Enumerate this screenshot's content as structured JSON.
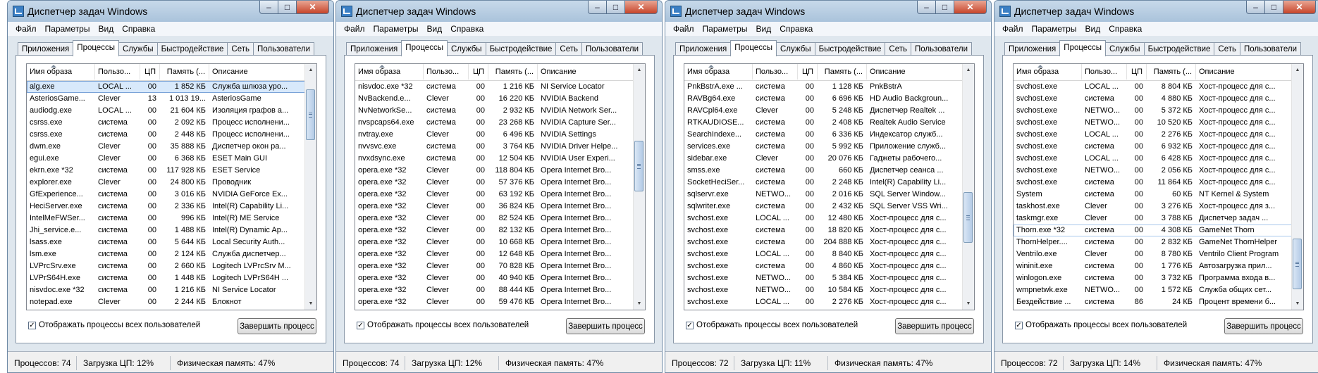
{
  "window": {
    "title": "Диспетчер задач Windows",
    "menu": [
      "Файл",
      "Параметры",
      "Вид",
      "Справка"
    ],
    "tabs": [
      "Приложения",
      "Процессы",
      "Службы",
      "Быстродействие",
      "Сеть",
      "Пользователи"
    ],
    "active_tab": "Процессы",
    "columns": [
      "Имя образа",
      "Пользо...",
      "ЦП",
      "Память (...",
      "Описание"
    ],
    "show_all_label": "Отображать процессы всех пользователей",
    "show_all_checked": true,
    "end_process_label": "Завершить процесс",
    "close_glyph": "✕",
    "minimize_glyph": "–",
    "maximize_glyph": "□"
  },
  "colors": {
    "titlebar": "#aac3db",
    "selection": "#d8e9fb",
    "close_button": "#c7452a"
  },
  "panels": [
    {
      "status": {
        "processes": "Процессов: 74",
        "cpu": "Загрузка ЦП: 12%",
        "memory": "Физическая память: 47%"
      },
      "scroll_position": 0.08,
      "selected_row": 0,
      "rows": [
        [
          "alg.exe",
          "LOCAL ...",
          "00",
          "1 852 КБ",
          "Служба шлюза уро..."
        ],
        [
          "AsteriosGame...",
          "Clever",
          "13",
          "1 013 19...",
          "AsteriosGame"
        ],
        [
          "audiodg.exe",
          "LOCAL ...",
          "00",
          "21 604 КБ",
          "Изоляция графов а..."
        ],
        [
          "csrss.exe",
          "система",
          "00",
          "2 092 КБ",
          "Процесс исполнени..."
        ],
        [
          "csrss.exe",
          "система",
          "00",
          "2 448 КБ",
          "Процесс исполнени..."
        ],
        [
          "dwm.exe",
          "Clever",
          "00",
          "35 888 КБ",
          "Диспетчер окон ра..."
        ],
        [
          "egui.exe",
          "Clever",
          "00",
          "6 368 КБ",
          "ESET Main GUI"
        ],
        [
          "ekrn.exe *32",
          "система",
          "00",
          "117 928 КБ",
          "ESET Service"
        ],
        [
          "explorer.exe",
          "Clever",
          "00",
          "24 800 КБ",
          "Проводник"
        ],
        [
          "GfExperience...",
          "система",
          "00",
          "3 016 КБ",
          "NVIDIA GeForce Ex..."
        ],
        [
          "HeciServer.exe",
          "система",
          "00",
          "2 336 КБ",
          "Intel(R) Capability Li..."
        ],
        [
          "IntelMeFWSer...",
          "система",
          "00",
          "996 КБ",
          "Intel(R) ME Service"
        ],
        [
          "Jhi_service.e...",
          "система",
          "00",
          "1 488 КБ",
          "Intel(R) Dynamic Ap..."
        ],
        [
          "lsass.exe",
          "система",
          "00",
          "5 644 КБ",
          "Local Security Auth..."
        ],
        [
          "lsm.exe",
          "система",
          "00",
          "2 124 КБ",
          "Служба диспетчер..."
        ],
        [
          "LVPrcSrv.exe",
          "система",
          "00",
          "2 660 КБ",
          "Logitech LVPrcSrv M..."
        ],
        [
          "LVPrS64H.exe",
          "система",
          "00",
          "1 448 КБ",
          "Logitech LVPrS64H ..."
        ],
        [
          "nisvdoc.exe *32",
          "система",
          "00",
          "1 216 КБ",
          "NI Service Locator"
        ],
        [
          "notepad.exe",
          "Clever",
          "00",
          "2 244 КБ",
          "Блокнот"
        ]
      ]
    },
    {
      "status": {
        "processes": "Процессов: 74",
        "cpu": "Загрузка ЦП: 12%",
        "memory": "Физическая память: 47%"
      },
      "scroll_position": 0.38,
      "selected_row": -1,
      "rows": [
        [
          "nisvdoc.exe *32",
          "система",
          "00",
          "1 216 КБ",
          "NI Service Locator"
        ],
        [
          "NvBackend.e...",
          "Clever",
          "00",
          "16 220 КБ",
          "NVIDIA Backend"
        ],
        [
          "NvNetworkSe...",
          "система",
          "00",
          "2 932 КБ",
          "NVIDIA Network Ser..."
        ],
        [
          "nvspcaps64.exe",
          "система",
          "00",
          "23 268 КБ",
          "NVIDIA Capture Ser..."
        ],
        [
          "nvtray.exe",
          "Clever",
          "00",
          "6 496 КБ",
          "NVIDIA Settings"
        ],
        [
          "nvvsvc.exe",
          "система",
          "00",
          "3 764 КБ",
          "NVIDIA Driver Helpe..."
        ],
        [
          "nvxdsync.exe",
          "система",
          "00",
          "12 504 КБ",
          "NVIDIA User Experi..."
        ],
        [
          "opera.exe *32",
          "Clever",
          "00",
          "118 804 КБ",
          "Opera Internet Bro..."
        ],
        [
          "opera.exe *32",
          "Clever",
          "00",
          "57 376 КБ",
          "Opera Internet Bro..."
        ],
        [
          "opera.exe *32",
          "Clever",
          "00",
          "63 192 КБ",
          "Opera Internet Bro..."
        ],
        [
          "opera.exe *32",
          "Clever",
          "00",
          "36 824 КБ",
          "Opera Internet Bro..."
        ],
        [
          "opera.exe *32",
          "Clever",
          "00",
          "82 524 КБ",
          "Opera Internet Bro..."
        ],
        [
          "opera.exe *32",
          "Clever",
          "00",
          "82 132 КБ",
          "Opera Internet Bro..."
        ],
        [
          "opera.exe *32",
          "Clever",
          "00",
          "10 668 КБ",
          "Opera Internet Bro..."
        ],
        [
          "opera.exe *32",
          "Clever",
          "00",
          "12 648 КБ",
          "Opera Internet Bro..."
        ],
        [
          "opera.exe *32",
          "Clever",
          "00",
          "70 828 КБ",
          "Opera Internet Bro..."
        ],
        [
          "opera.exe *32",
          "Clever",
          "00",
          "40 940 КБ",
          "Opera Internet Bro..."
        ],
        [
          "opera.exe *32",
          "Clever",
          "00",
          "88 444 КБ",
          "Opera Internet Bro..."
        ],
        [
          "opera.exe *32",
          "Clever",
          "00",
          "59 476 КБ",
          "Opera Internet Bro..."
        ]
      ]
    },
    {
      "status": {
        "processes": "Процессов: 72",
        "cpu": "Загрузка ЦП: 11%",
        "memory": "Физическая память: 47%"
      },
      "scroll_position": 0.68,
      "selected_row": -1,
      "rows": [
        [
          "PnkBstrA.exe ...",
          "система",
          "00",
          "1 128 КБ",
          "PnkBstrA"
        ],
        [
          "RAVBg64.exe",
          "система",
          "00",
          "6 696 КБ",
          "HD Audio Backgroun..."
        ],
        [
          "RAVCpl64.exe",
          "Clever",
          "00",
          "5 248 КБ",
          "Диспетчер Realtek ..."
        ],
        [
          "RTKAUDIOSE...",
          "система",
          "00",
          "2 408 КБ",
          "Realtek Audio Service"
        ],
        [
          "SearchIndexe...",
          "система",
          "00",
          "6 336 КБ",
          "Индексатор служб..."
        ],
        [
          "services.exe",
          "система",
          "00",
          "5 992 КБ",
          "Приложение служб..."
        ],
        [
          "sidebar.exe",
          "Clever",
          "00",
          "20 076 КБ",
          "Гаджеты рабочего..."
        ],
        [
          "smss.exe",
          "система",
          "00",
          "660 КБ",
          "Диспетчер сеанса ..."
        ],
        [
          "SocketHeciSer...",
          "система",
          "00",
          "2 248 КБ",
          "Intel(R) Capability Li..."
        ],
        [
          "sqlservr.exe",
          "NETWO...",
          "00",
          "2 016 КБ",
          "SQL Server Window..."
        ],
        [
          "sqlwriter.exe",
          "система",
          "00",
          "2 432 КБ",
          "SQL Server VSS Wri..."
        ],
        [
          "svchost.exe",
          "LOCAL ...",
          "00",
          "12 480 КБ",
          "Хост-процесс для с..."
        ],
        [
          "svchost.exe",
          "система",
          "00",
          "18 820 КБ",
          "Хост-процесс для с..."
        ],
        [
          "svchost.exe",
          "система",
          "00",
          "204 888 КБ",
          "Хост-процесс для с..."
        ],
        [
          "svchost.exe",
          "LOCAL ...",
          "00",
          "8 840 КБ",
          "Хост-процесс для с..."
        ],
        [
          "svchost.exe",
          "система",
          "00",
          "4 860 КБ",
          "Хост-процесс для с..."
        ],
        [
          "svchost.exe",
          "NETWO...",
          "00",
          "5 384 КБ",
          "Хост-процесс для с..."
        ],
        [
          "svchost.exe",
          "NETWO...",
          "00",
          "10 584 КБ",
          "Хост-процесс для с..."
        ],
        [
          "svchost.exe",
          "LOCAL ...",
          "00",
          "2 276 КБ",
          "Хост-процесс для с..."
        ]
      ]
    },
    {
      "status": {
        "processes": "Процессов: 72",
        "cpu": "Загрузка ЦП: 14%",
        "memory": "Физическая память: 47%"
      },
      "scroll_position": 0.95,
      "selected_row": 12,
      "rows": [
        [
          "svchost.exe",
          "LOCAL ...",
          "00",
          "8 804 КБ",
          "Хост-процесс для с..."
        ],
        [
          "svchost.exe",
          "система",
          "00",
          "4 880 КБ",
          "Хост-процесс для с..."
        ],
        [
          "svchost.exe",
          "NETWO...",
          "00",
          "5 372 КБ",
          "Хост-процесс для с..."
        ],
        [
          "svchost.exe",
          "NETWO...",
          "00",
          "10 520 КБ",
          "Хост-процесс для с..."
        ],
        [
          "svchost.exe",
          "LOCAL ...",
          "00",
          "2 276 КБ",
          "Хост-процесс для с..."
        ],
        [
          "svchost.exe",
          "система",
          "00",
          "6 932 КБ",
          "Хост-процесс для с..."
        ],
        [
          "svchost.exe",
          "LOCAL ...",
          "00",
          "6 428 КБ",
          "Хост-процесс для с..."
        ],
        [
          "svchost.exe",
          "NETWO...",
          "00",
          "2 056 КБ",
          "Хост-процесс для с..."
        ],
        [
          "svchost.exe",
          "система",
          "00",
          "11 864 КБ",
          "Хост-процесс для с..."
        ],
        [
          "System",
          "система",
          "00",
          "60 КБ",
          "NT Kernel & System"
        ],
        [
          "taskhost.exe",
          "Clever",
          "00",
          "3 276 КБ",
          "Хост-процесс для з..."
        ],
        [
          "taskmgr.exe",
          "Clever",
          "00",
          "3 788 КБ",
          "Диспетчер задач ..."
        ],
        [
          "Thorn.exe *32",
          "система",
          "00",
          "4 308 КБ",
          "GameNet Thorn"
        ],
        [
          "ThornHelper....",
          "система",
          "00",
          "2 832 КБ",
          "GameNet ThornHelper"
        ],
        [
          "Ventrilo.exe",
          "Clever",
          "00",
          "8 780 КБ",
          "Ventrilo Client Program"
        ],
        [
          "wininit.exe",
          "система",
          "00",
          "1 776 КБ",
          "Автозагрузка прил..."
        ],
        [
          "winlogon.exe",
          "система",
          "00",
          "3 732 КБ",
          "Программа входа в..."
        ],
        [
          "wmpnetwk.exe",
          "NETWO...",
          "00",
          "1 572 КБ",
          "Служба общих сет..."
        ],
        [
          "Бездействие ...",
          "система",
          "86",
          "24 КБ",
          "Процент времени б..."
        ]
      ]
    }
  ]
}
